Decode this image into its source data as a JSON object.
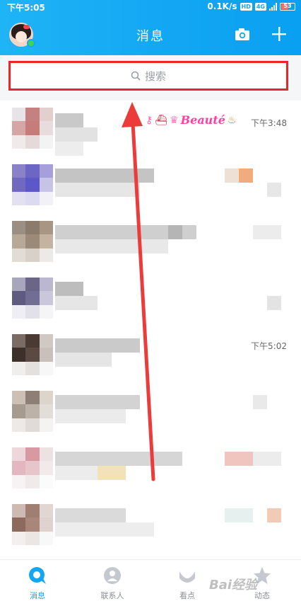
{
  "status_bar": {
    "time": "下午5:05",
    "net_speed": "0.1K/s",
    "hd": "HD",
    "signal": "4G",
    "battery": "53"
  },
  "header": {
    "title": "消息"
  },
  "search": {
    "placeholder": "搜索"
  },
  "conversations": [
    {
      "time": "下午3:48",
      "title": "",
      "extra": "Beauté"
    },
    {
      "time": "",
      "title": ""
    },
    {
      "time": "",
      "title": ""
    },
    {
      "time": "",
      "title": ""
    },
    {
      "time": "下午5:02",
      "title": ""
    },
    {
      "time": "",
      "title": ""
    },
    {
      "time": "",
      "title": ""
    },
    {
      "time": "",
      "title": ""
    }
  ],
  "bottom_nav": [
    {
      "label": "消息",
      "active": true
    },
    {
      "label": "联系人",
      "active": false
    },
    {
      "label": "看点",
      "active": false
    },
    {
      "label": "动态",
      "active": false
    }
  ],
  "watermark": "Bai经验",
  "colors": {
    "brand": "#12a6f3",
    "highlight": "#e9262b",
    "online": "#3fd54f"
  }
}
